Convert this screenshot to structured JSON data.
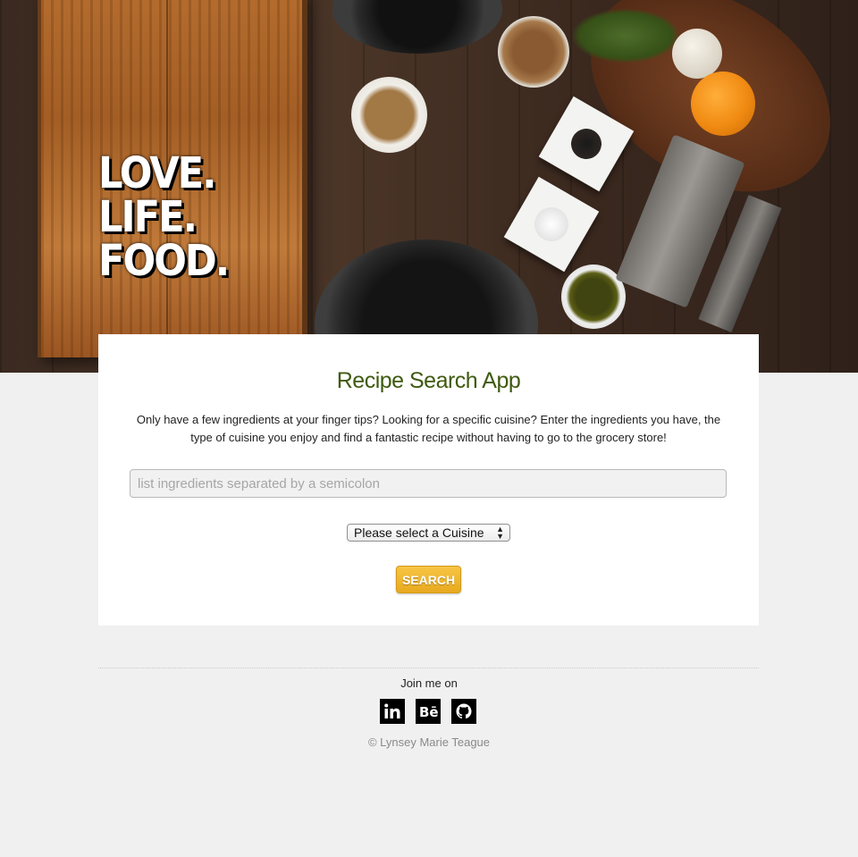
{
  "hero": {
    "tagline": [
      "LOVE.",
      "LIFE.",
      "FOOD."
    ]
  },
  "card": {
    "title": "Recipe Search App",
    "description": "Only have a few ingredients at your finger tips? Looking for a specific cuisine? Enter the ingredients you have, the type of cuisine you enjoy and find a fantastic recipe without having to go to the grocery store!",
    "ingredients_input": {
      "value": "",
      "placeholder": "list ingredients separated by a semicolon"
    },
    "cuisine_select": {
      "selected": "Please select a Cuisine"
    },
    "search_label": "SEARCH"
  },
  "footer": {
    "join_text": "Join me on",
    "socials": [
      {
        "name": "LinkedIn",
        "icon": "linkedin-icon"
      },
      {
        "name": "Behance",
        "icon": "behance-icon"
      },
      {
        "name": "GitHub",
        "icon": "github-icon"
      }
    ],
    "copyright": "© Lynsey Marie Teague"
  },
  "colors": {
    "page_background": "#f0f0f0",
    "title_green": "#3f5a10",
    "search_button": "#f0b42c"
  }
}
